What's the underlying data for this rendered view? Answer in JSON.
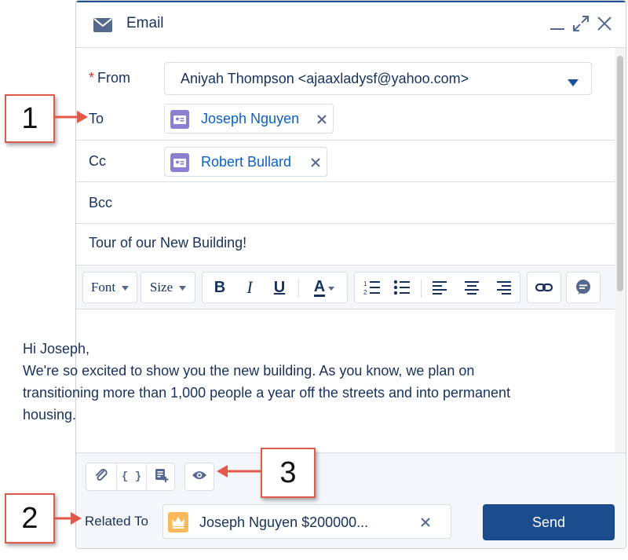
{
  "window": {
    "title": "Email"
  },
  "from": {
    "label": "From",
    "required_mark": "*",
    "value": "Aniyah Thompson <ajaaxladysf@yahoo.com>"
  },
  "to": {
    "label": "To",
    "recipient": "Joseph Nguyen"
  },
  "cc": {
    "label": "Cc",
    "recipient": "Robert Bullard"
  },
  "bcc": {
    "label": "Bcc"
  },
  "subject": {
    "value": "Tour of our New Building!"
  },
  "toolbar": {
    "font_label": "Font",
    "size_label": "Size",
    "bold": "B",
    "italic": "I",
    "underline": "U",
    "text_color": "A",
    "ordered_marks": [
      "1",
      "2"
    ]
  },
  "body": {
    "lines": [
      "Hi Joseph,",
      "We're so excited to show you the new building. As you know, we plan on transitioning more than 1,000 people a year off the streets and into permanent housing."
    ]
  },
  "merge_field_glyph": "{ }",
  "related": {
    "label": "Related To",
    "value": "Joseph Nguyen $200000..."
  },
  "send": {
    "label": "Send"
  },
  "callouts": {
    "one": "1",
    "two": "2",
    "three": "3"
  },
  "colors": {
    "brand_blue": "#1b5297",
    "send_button": "#1a4c8e",
    "link_blue": "#0b61c3",
    "contact_icon": "#8b7fd1",
    "opportunity_icon": "#fcb95b",
    "callout_red": "#e05a4a"
  }
}
